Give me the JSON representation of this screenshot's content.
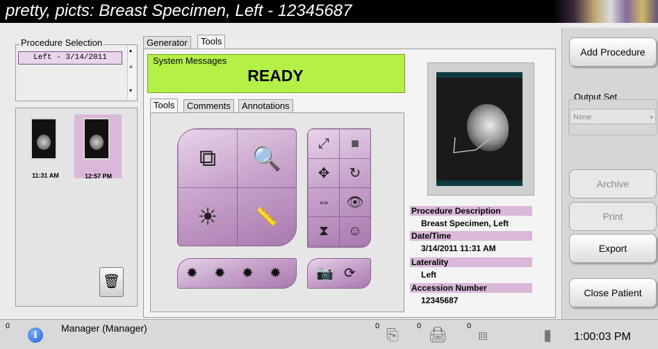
{
  "window": {
    "title": "pretty, picts:  Breast Specimen, Left - 12345687"
  },
  "procedure_selection": {
    "label": "Procedure Selection",
    "items": [
      {
        "label": "Left - 3/14/2011"
      }
    ]
  },
  "thumbnails": [
    {
      "time": "11:31 AM"
    },
    {
      "time": "12:57 PM",
      "selected": true
    }
  ],
  "tabs": {
    "generator": "Generator",
    "tools": "Tools"
  },
  "system_messages": {
    "label": "System Messages",
    "status": "READY"
  },
  "subtabs": {
    "tools": "Tools",
    "comments": "Comments",
    "annotations": "Annotations"
  },
  "icons": {
    "trash": "trash-icon",
    "info": "info-icon"
  },
  "procedure_info": {
    "description_label": "Procedure Description",
    "description": "Breast Specimen, Left",
    "datetime_label": "Date/Time",
    "datetime": "3/14/2011 11:31 AM",
    "laterality_label": "Laterality",
    "laterality": "Left",
    "accession_label": "Accession Number",
    "accession": "12345687"
  },
  "right_panel": {
    "add_procedure": "Add Procedure",
    "output_set_label": "Output Set",
    "output_set_value": "None",
    "archive": "Archive",
    "print": "Print",
    "export": "Export",
    "close_patient": "Close Patient"
  },
  "statusbar": {
    "alerts_count": "0",
    "user": "Manager (Manager)",
    "queue1_count": "0",
    "queue2_count": "0",
    "queue3_count": "0",
    "clock": "1:00:03 PM"
  },
  "colors": {
    "accent": "#b4f046",
    "selection": "#d9b8da",
    "tool_purple": "#c8a5cc"
  }
}
